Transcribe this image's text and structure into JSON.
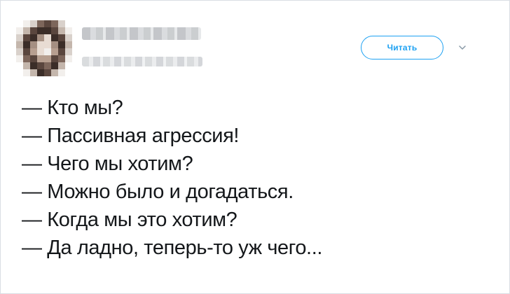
{
  "tweet": {
    "follow_button_label": "Читать",
    "lines": [
      "— Кто мы?",
      "— Пассивная агрессия!",
      "— Чего мы хотим?",
      "— Можно было и догадаться.",
      "— Когда мы это хотим?",
      "— Да ладно, теперь-то уж чего..."
    ]
  },
  "icons": {
    "menu": "chevron-down-icon",
    "avatar": "pixelated-avatar"
  },
  "colors": {
    "accent": "#1da1f2",
    "text": "#14171a",
    "border": "#d9dee3"
  }
}
